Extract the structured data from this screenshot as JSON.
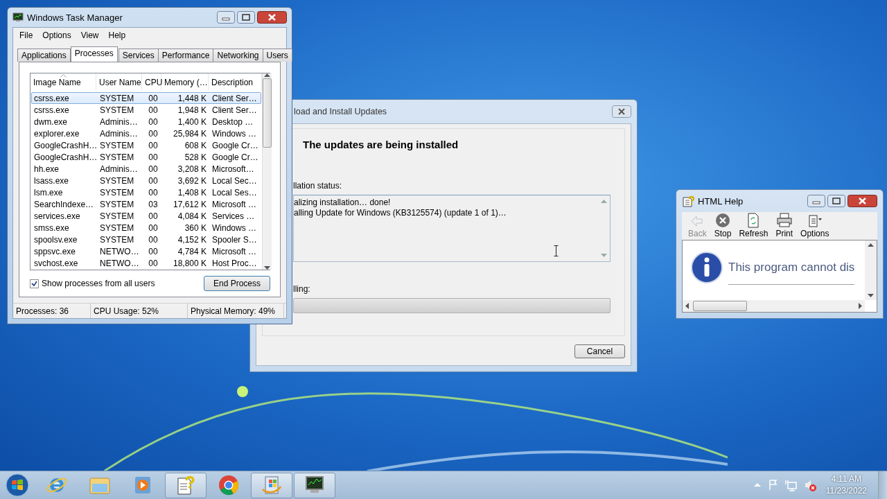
{
  "task_manager": {
    "title": "Windows Task Manager",
    "menu": [
      "File",
      "Options",
      "View",
      "Help"
    ],
    "tabs": [
      {
        "label": "Applications",
        "selected": false
      },
      {
        "label": "Processes",
        "selected": true
      },
      {
        "label": "Services",
        "selected": false
      },
      {
        "label": "Performance",
        "selected": false
      },
      {
        "label": "Networking",
        "selected": false
      },
      {
        "label": "Users",
        "selected": false
      }
    ],
    "columns": [
      {
        "label": "Image Name",
        "sorted": true
      },
      {
        "label": "User Name",
        "sorted": false
      },
      {
        "label": "CPU",
        "sorted": false
      },
      {
        "label": "Memory (…",
        "sorted": false
      },
      {
        "label": "Description",
        "sorted": false
      }
    ],
    "rows": [
      {
        "cells": [
          "csrss.exe",
          "SYSTEM",
          "00",
          "1,448 K",
          "Client Ser…"
        ],
        "selected": true
      },
      {
        "cells": [
          "csrss.exe",
          "SYSTEM",
          "00",
          "1,948 K",
          "Client Ser…"
        ],
        "selected": false
      },
      {
        "cells": [
          "dwm.exe",
          "Adminis…",
          "00",
          "1,400 K",
          "Desktop …"
        ],
        "selected": false
      },
      {
        "cells": [
          "explorer.exe",
          "Adminis…",
          "00",
          "25,984 K",
          "Windows …"
        ],
        "selected": false
      },
      {
        "cells": [
          "GoogleCrashH…",
          "SYSTEM",
          "00",
          "608 K",
          "Google Cr…"
        ],
        "selected": false
      },
      {
        "cells": [
          "GoogleCrashH…",
          "SYSTEM",
          "00",
          "528 K",
          "Google Cr…"
        ],
        "selected": false
      },
      {
        "cells": [
          "hh.exe",
          "Adminis…",
          "00",
          "3,208 K",
          "Microsoft…"
        ],
        "selected": false
      },
      {
        "cells": [
          "lsass.exe",
          "SYSTEM",
          "00",
          "3,692 K",
          "Local Sec…"
        ],
        "selected": false
      },
      {
        "cells": [
          "lsm.exe",
          "SYSTEM",
          "00",
          "1,408 K",
          "Local Ses…"
        ],
        "selected": false
      },
      {
        "cells": [
          "SearchIndexe…",
          "SYSTEM",
          "03",
          "17,612 K",
          "Microsoft …"
        ],
        "selected": false
      },
      {
        "cells": [
          "services.exe",
          "SYSTEM",
          "00",
          "4,084 K",
          "Services …"
        ],
        "selected": false
      },
      {
        "cells": [
          "smss.exe",
          "SYSTEM",
          "00",
          "360 K",
          "Windows …"
        ],
        "selected": false
      },
      {
        "cells": [
          "spoolsv.exe",
          "SYSTEM",
          "00",
          "4,152 K",
          "Spooler S…"
        ],
        "selected": false
      },
      {
        "cells": [
          "sppsvc.exe",
          "NETWO…",
          "00",
          "4,784 K",
          "Microsoft …"
        ],
        "selected": false
      },
      {
        "cells": [
          "svchost.exe",
          "NETWO…",
          "00",
          "18,800 K",
          "Host Proc…"
        ],
        "selected": false
      }
    ],
    "show_all_users": {
      "label": "Show processes from all users",
      "checked": true
    },
    "end_process": "End Process",
    "status": [
      "Processes: 36",
      "CPU Usage: 52%",
      "Physical Memory: 49%"
    ]
  },
  "update_dialog": {
    "title": "load and Install Updates",
    "heading": "The updates are being installed",
    "status_label": "llation status:",
    "status_lines": [
      "alizing installation… done!",
      "alling Update for Windows (KB3125574) (update 1 of 1)…"
    ],
    "progress_label": "lling:",
    "progress": {
      "level": 0
    },
    "cancel": "Cancel"
  },
  "help_window": {
    "title": "HTML Help",
    "toolbar": [
      {
        "kind": "back",
        "label": "Back",
        "disabled": true
      },
      {
        "kind": "stop",
        "label": "Stop",
        "disabled": false
      },
      {
        "kind": "refresh",
        "label": "Refresh",
        "disabled": false
      },
      {
        "kind": "print",
        "label": "Print",
        "disabled": false
      },
      {
        "kind": "options",
        "label": "Options",
        "disabled": false
      }
    ],
    "message": "This program cannot dis"
  },
  "taskbar": {
    "apps": [
      {
        "kind": "ie",
        "open": false
      },
      {
        "kind": "explorer",
        "open": false
      },
      {
        "kind": "media",
        "open": false
      },
      {
        "kind": "help",
        "open": true
      },
      {
        "kind": "chrome",
        "open": false
      },
      {
        "kind": "update",
        "open": true
      },
      {
        "kind": "taskmgr",
        "open": true
      }
    ],
    "time": "4:11 AM",
    "date": "11/23/2022"
  }
}
